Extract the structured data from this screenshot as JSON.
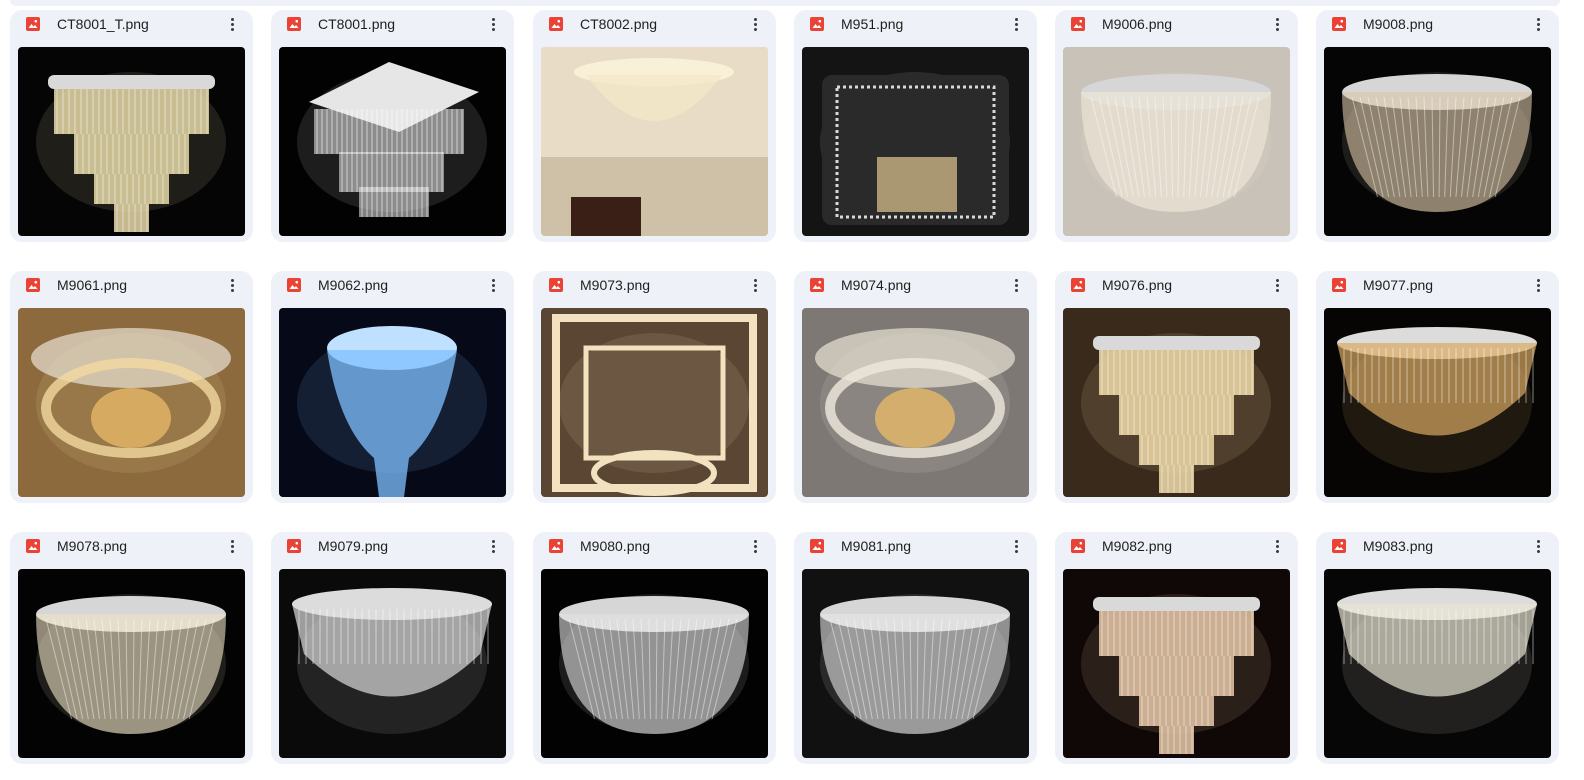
{
  "files": [
    {
      "name": "CT8001_T.png",
      "bg": "#050505",
      "accent": "#e8d9a8",
      "style": "tier"
    },
    {
      "name": "CT8001.png",
      "bg": "#020202",
      "accent": "#e8e8e8",
      "style": "square"
    },
    {
      "name": "CT8002.png",
      "bg": "#d8cbb8",
      "accent": "#f3e8c8",
      "style": "room"
    },
    {
      "name": "M951.png",
      "bg": "#141414",
      "accent": "#d9d9d9",
      "style": "rect"
    },
    {
      "name": "M9006.png",
      "bg": "#c9c2b8",
      "accent": "#f1ead8",
      "style": "dome"
    },
    {
      "name": "M9008.png",
      "bg": "#050505",
      "accent": "#d8c5a6",
      "style": "dome"
    },
    {
      "name": "M9061.png",
      "bg": "#8c6a3e",
      "accent": "#f2d9a0",
      "style": "ring"
    },
    {
      "name": "M9062.png",
      "bg": "#060a18",
      "accent": "#7fc0ff",
      "style": "drop"
    },
    {
      "name": "M9073.png",
      "bg": "#5a4632",
      "accent": "#f2e2c0",
      "style": "frame"
    },
    {
      "name": "M9074.png",
      "bg": "#7d7874",
      "accent": "#efe8dd",
      "style": "ring"
    },
    {
      "name": "M9076.png",
      "bg": "#3a2a1c",
      "accent": "#f0dba8",
      "style": "tier"
    },
    {
      "name": "M9077.png",
      "bg": "#060504",
      "accent": "#d9a962",
      "style": "bowl"
    },
    {
      "name": "M9078.png",
      "bg": "#030303",
      "accent": "#efe3c6",
      "style": "dome"
    },
    {
      "name": "M9079.png",
      "bg": "#0a0a0a",
      "accent": "#dcdcdc",
      "style": "bowl"
    },
    {
      "name": "M9080.png",
      "bg": "#020202",
      "accent": "#e2e2e2",
      "style": "dome"
    },
    {
      "name": "M9081.png",
      "bg": "#111111",
      "accent": "#e6e6e6",
      "style": "dome"
    },
    {
      "name": "M9082.png",
      "bg": "#100806",
      "accent": "#e9c9a8",
      "style": "tier"
    },
    {
      "name": "M9083.png",
      "bg": "#060606",
      "accent": "#e7e2d2",
      "style": "bowl"
    }
  ],
  "icon_color": "#ea4335"
}
